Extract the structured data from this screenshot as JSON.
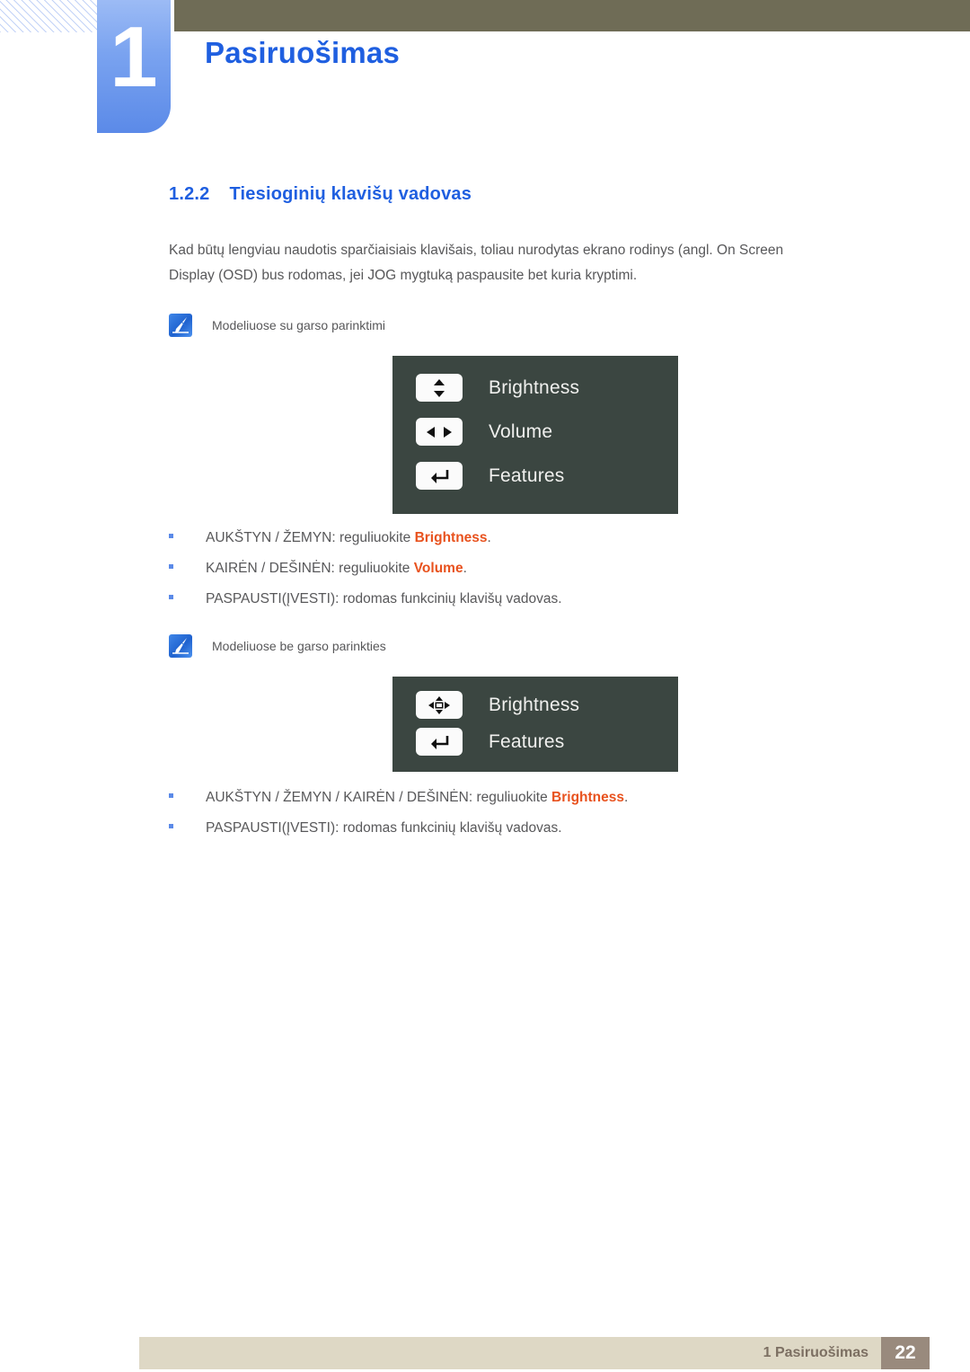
{
  "header": {
    "chapter_number": "1",
    "chapter_title": "Pasiruošimas"
  },
  "section": {
    "number": "1.2.2",
    "title": "Tiesioginių klavišų vadovas",
    "intro": "Kad būtų lengviau naudotis sparčiaisiais klavišais, toliau nurodytas ekrano rodinys (angl. On Screen Display (OSD) bus rodomas, jei JOG mygtuką paspausite bet kuria kryptimi."
  },
  "blocks": [
    {
      "note": "Modeliuose su garso parinktimi",
      "osd_rows": [
        {
          "icon": "up-down-arrows-icon",
          "label": "Brightness"
        },
        {
          "icon": "left-right-arrows-icon",
          "label": "Volume"
        },
        {
          "icon": "enter-arrow-icon",
          "label": "Features"
        }
      ],
      "bullets": [
        {
          "pre": "AUKŠTYN / ŽEMYN: reguliuokite ",
          "highlight": "Brightness",
          "post": "."
        },
        {
          "pre": "KAIRĖN / DEŠINĖN: reguliuokite ",
          "highlight": "Volume",
          "post": "."
        },
        {
          "pre": "PASPAUSTI(ĮVESTI): rodomas funkcinių klavišų vadovas.",
          "highlight": "",
          "post": ""
        }
      ]
    },
    {
      "note": "Modeliuose be garso parinkties",
      "osd_rows": [
        {
          "icon": "four-way-arrows-icon",
          "label": "Brightness"
        },
        {
          "icon": "enter-arrow-icon",
          "label": "Features"
        }
      ],
      "bullets": [
        {
          "pre": "AUKŠTYN / ŽEMYN / KAIRĖN / DEŠINĖN: reguliuokite ",
          "highlight": "Brightness",
          "post": "."
        },
        {
          "pre": "PASPAUSTI(ĮVESTI): rodomas funkcinių klavišų vadovas.",
          "highlight": "",
          "post": ""
        }
      ]
    }
  ],
  "footer": {
    "label": "1 Pasiruošimas",
    "page": "22"
  },
  "colors": {
    "accent_blue": "#1f5fe0",
    "olive_bar": "#6f6c56",
    "osd_background": "#3b4641",
    "highlight_orange": "#e8521e",
    "footer_bar": "#ded8c5",
    "footer_page_box": "#998a7d"
  }
}
